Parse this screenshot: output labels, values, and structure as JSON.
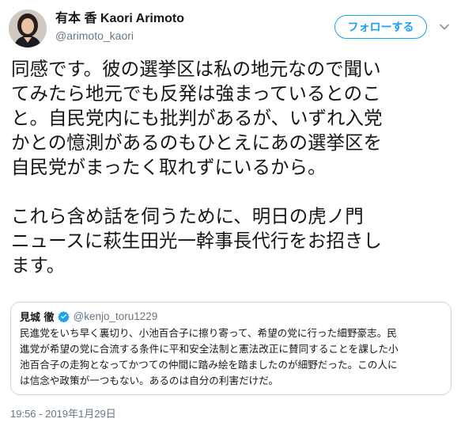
{
  "author": {
    "display_name": "有本 香 Kaori Arimoto",
    "handle": "@arimoto_kaori",
    "avatar_icon": "user-avatar"
  },
  "follow_button": {
    "label": "フォローする"
  },
  "menu": {
    "icon": "chevron-down-icon"
  },
  "tweet": {
    "lines": [
      "同感です。彼の選挙区は私の地元なので聞い",
      "てみたら地元でも反発は強まっているとのこ",
      "と。自民党内にも批判があるが、いずれ入党",
      "かとの憶測があるのもひとえにあの選挙区を",
      "自民党がまったく取れずにいるから。",
      "",
      "これら含め話を伺うために、明日の虎ノ門",
      "ニュースに萩生田光一幹事長代行をお招きし",
      "ます。"
    ]
  },
  "quoted_tweet": {
    "display_name": "見城 徹",
    "verified_icon": "verified-badge-icon",
    "handle": "@kenjo_toru1229",
    "lines": [
      "民進党をいち早く裏切り、小池百合子に擦り寄って、希望の党に行った細野豪志。民",
      "進党が希望の党に合流する条件に平和安全法制と憲法改正に賛同することを課した小",
      "池百合子の走狗となってかつての仲間に踏み絵を踏ましたのが細野だった。この人に",
      "は信念や政策が一つもない。あるのは自分の利害だけだ。"
    ]
  },
  "timestamp": "19:56 - 2019年1月29日",
  "colors": {
    "accent": "#1da1f2",
    "text": "#14171a",
    "secondary": "#657786",
    "border": "#ccd6dd"
  }
}
